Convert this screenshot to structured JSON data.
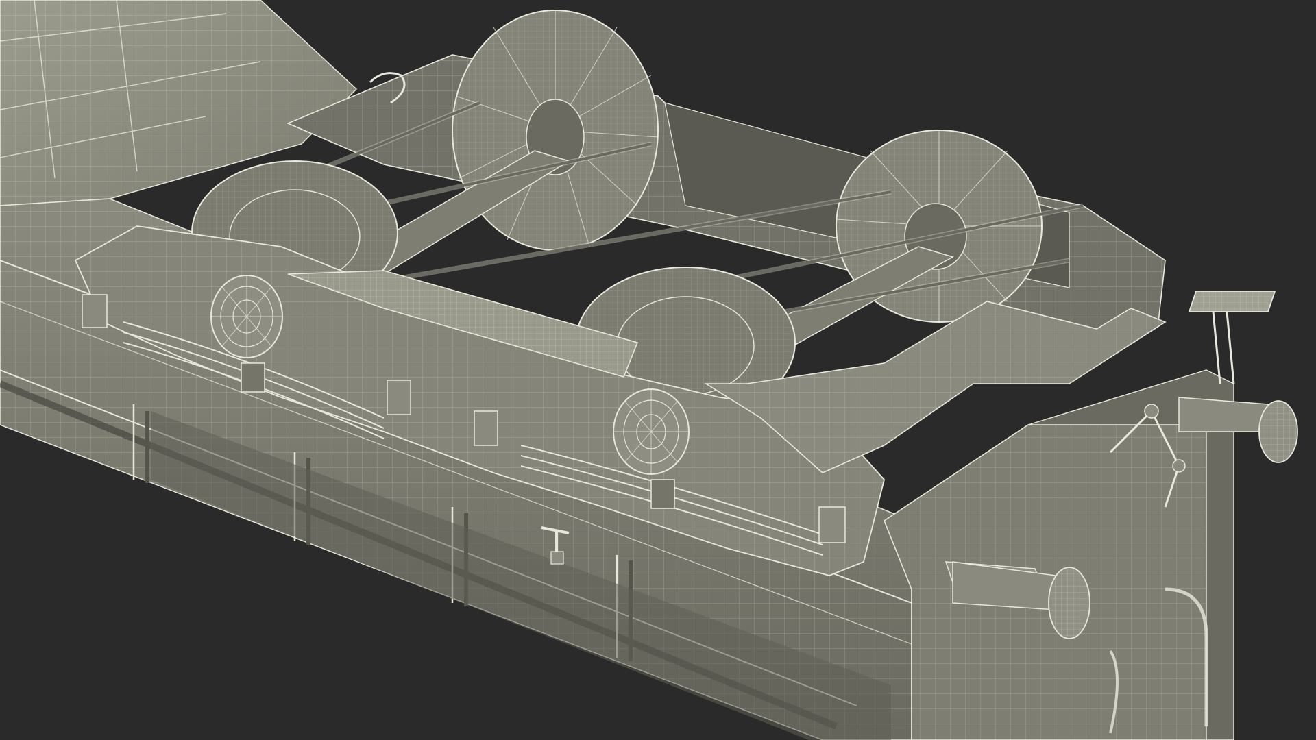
{
  "scene": {
    "subject": "railcar-bogie-wireframe-render",
    "colors": {
      "background": "#2a2a2a",
      "body_light": "#9a9a8c",
      "body_mid": "#7a7a6e",
      "body_dark": "#55554c",
      "shadow": "#3e3e38",
      "wire": "#e8e8dc"
    }
  }
}
